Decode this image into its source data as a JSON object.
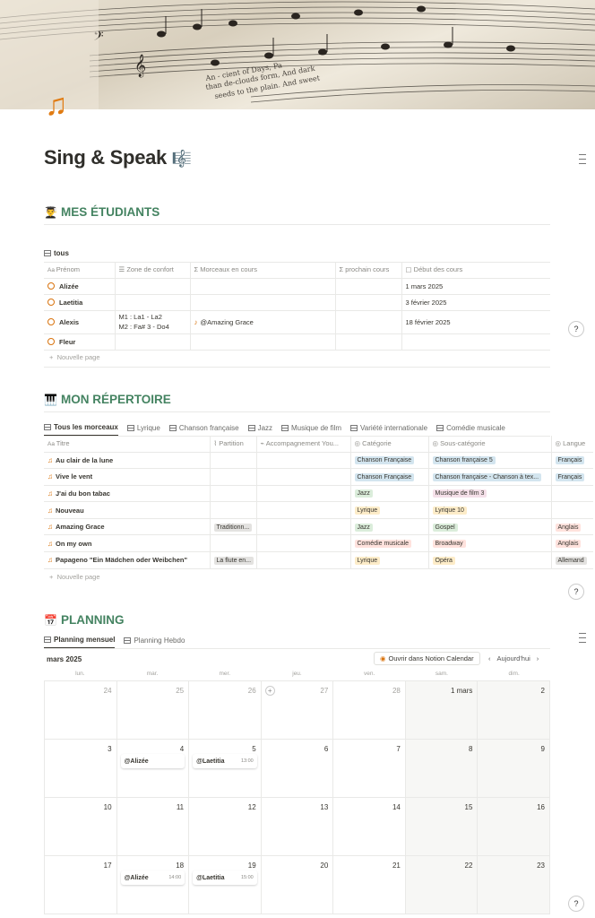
{
  "page": {
    "title": "Sing & Speak",
    "title_emoji": "🎼",
    "icon": "music-notes-icon"
  },
  "students": {
    "heading": "MES ÉTUDIANTS",
    "heading_emoji": "👨‍🎓",
    "view": "tous",
    "columns": [
      "Prénom",
      "Zone de confort",
      "Morceaux en cours",
      "prochain cours",
      "Début des cours"
    ],
    "rows": [
      {
        "name": "Alizée",
        "zone": "",
        "morceaux": "",
        "prochain": "",
        "debut": "1 mars 2025"
      },
      {
        "name": "Laetitia",
        "zone": "",
        "morceaux": "",
        "prochain": "",
        "debut": "3 février 2025"
      },
      {
        "name": "Alexis",
        "zone": "M1 : La1 - La2",
        "zone2": "M2 : Fa# 3 - Do4",
        "morceaux": "@Amazing Grace",
        "prochain": "",
        "debut": "18 février 2025"
      },
      {
        "name": "Fleur",
        "zone": "",
        "morceaux": "",
        "prochain": "",
        "debut": ""
      }
    ],
    "new_page": "Nouvelle page"
  },
  "repertoire": {
    "heading": "MON RÉPERTOIRE",
    "heading_emoji": "🎹",
    "tabs": [
      "Tous les morceaux",
      "Lyrique",
      "Chanson française",
      "Jazz",
      "Musique de film",
      "Variété internationale",
      "Comédie musicale"
    ],
    "columns": [
      "Titre",
      "Partition",
      "Accompagnement You...",
      "Catégorie",
      "Sous-catégorie",
      "Langue"
    ],
    "rows": [
      {
        "title": "Au clair de la lune",
        "partition": "",
        "accomp": "",
        "cat": "Chanson Française",
        "cat_color": "#d3e5ef",
        "sub": "Chanson française 5",
        "sub_color": "#d3e5ef",
        "lang": "Français",
        "lang_color": "#d3e5ef"
      },
      {
        "title": "Vive le vent",
        "partition": "",
        "accomp": "",
        "cat": "Chanson Française",
        "cat_color": "#d3e5ef",
        "sub": "Chanson française - Chanson à tex...",
        "sub_color": "#d3e5ef",
        "lang": "Français",
        "lang_color": "#d3e5ef"
      },
      {
        "title": "J'ai du bon tabac",
        "partition": "",
        "accomp": "",
        "cat": "Jazz",
        "cat_color": "#dbeddb",
        "sub": "Musique de film 3",
        "sub_color": "#f5e0e9",
        "lang": "",
        "lang_color": ""
      },
      {
        "title": "Nouveau",
        "partition": "",
        "accomp": "",
        "cat": "Lyrique",
        "cat_color": "#fdecc8",
        "sub": "Lyrique 10",
        "sub_color": "#fdecc8",
        "lang": "",
        "lang_color": ""
      },
      {
        "title": "Amazing Grace",
        "partition": "Traditionn...",
        "accomp": "",
        "cat": "Jazz",
        "cat_color": "#dbeddb",
        "sub": "Gospel",
        "sub_color": "#dbeddb",
        "lang": "Anglais",
        "lang_color": "#ffe2dd"
      },
      {
        "title": "On my own",
        "partition": "",
        "accomp": "",
        "cat": "Comédie musicale",
        "cat_color": "#ffe2dd",
        "sub": "Broadway",
        "sub_color": "#ffe2dd",
        "lang": "Anglais",
        "lang_color": "#ffe2dd"
      },
      {
        "title": "Papageno \"Ein Mädchen oder Weibchen\"",
        "partition": "La flute en...",
        "accomp": "",
        "cat": "Lyrique",
        "cat_color": "#fdecc8",
        "sub": "Opéra",
        "sub_color": "#fdecc8",
        "lang": "Allemand",
        "lang_color": "#e3e2e0"
      }
    ],
    "new_page": "Nouvelle page"
  },
  "planning": {
    "heading": "PLANNING",
    "heading_emoji": "📅",
    "tabs": [
      "Planning mensuel",
      "Planning Hebdo"
    ],
    "month": "mars 2025",
    "open_btn": "Ouvrir dans Notion Calendar",
    "today": "Aujourd'hui",
    "weekdays": [
      "lun.",
      "mar.",
      "mer.",
      "jeu.",
      "ven.",
      "sam.",
      "dim."
    ],
    "weeks": [
      [
        "24",
        "25",
        "26",
        "27",
        "28",
        "1 mars",
        "2"
      ],
      [
        "3",
        "4",
        "5",
        "6",
        "7",
        "8",
        "9"
      ],
      [
        "10",
        "11",
        "12",
        "13",
        "14",
        "15",
        "16"
      ],
      [
        "17",
        "18",
        "19",
        "20",
        "21",
        "22",
        "23"
      ]
    ],
    "events": [
      {
        "week": 1,
        "day": 1,
        "label": "@Alizée",
        "time": ""
      },
      {
        "week": 1,
        "day": 2,
        "label": "@Laetitia",
        "time": "13:00"
      },
      {
        "week": 3,
        "day": 1,
        "label": "@Alizée",
        "time": "14:00"
      },
      {
        "week": 3,
        "day": 2,
        "label": "@Laetitia",
        "time": "15:00"
      }
    ]
  }
}
